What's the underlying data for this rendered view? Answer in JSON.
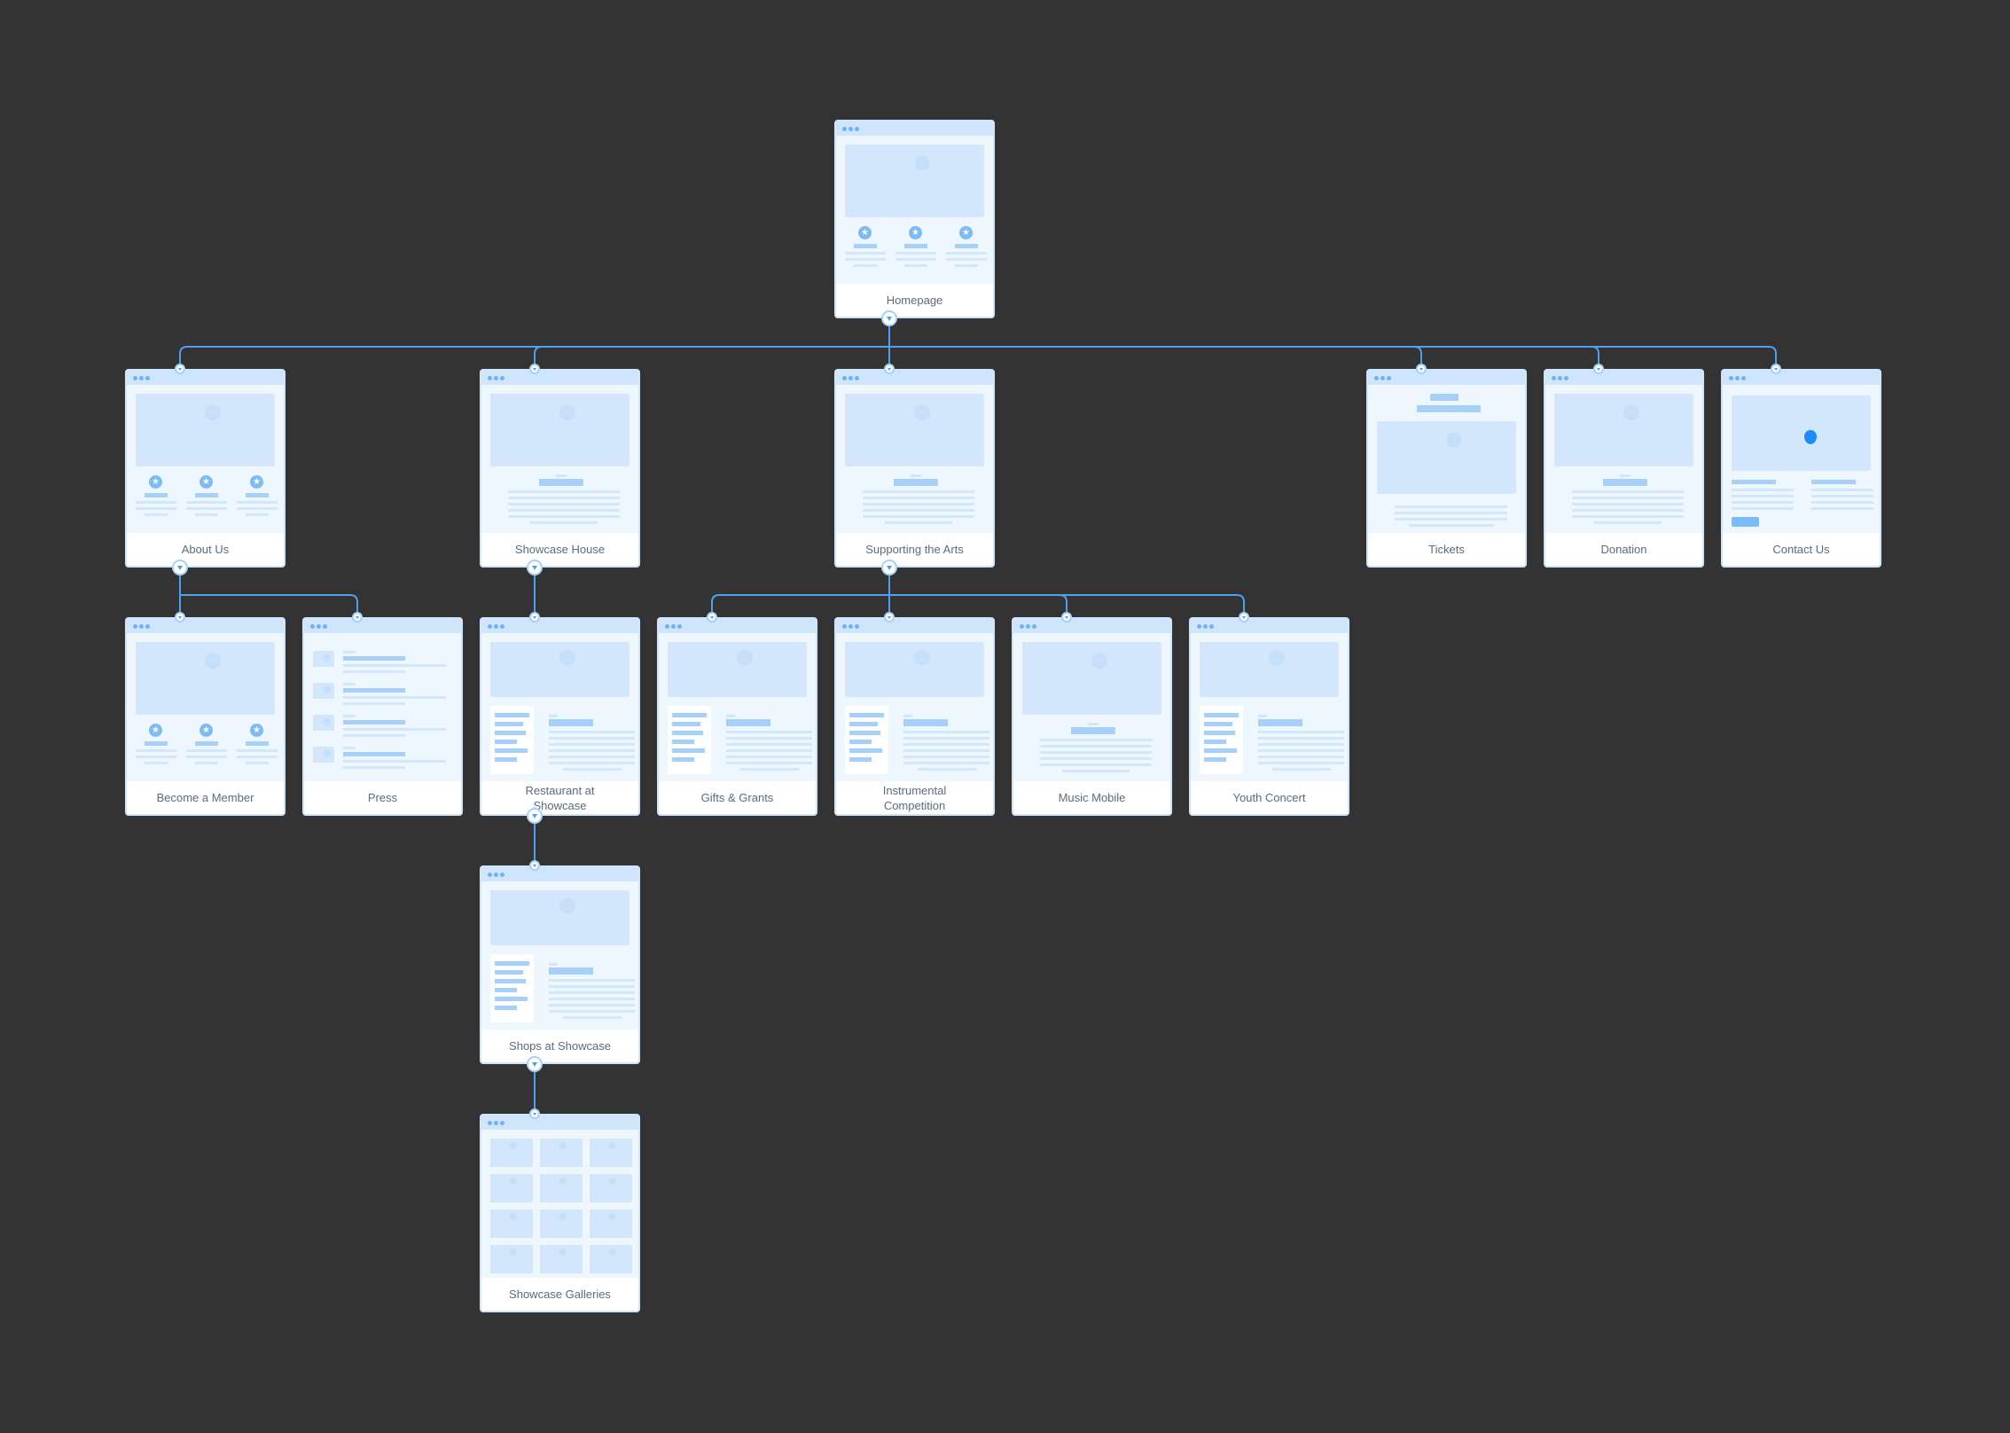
{
  "diagram": {
    "type": "sitemap",
    "connector_color": "#4d9ff0",
    "card_colors": {
      "frame": "#cfe5fb",
      "body": "#eef6fe",
      "accent": "#a7d0f8",
      "pin": "#1a8cff"
    },
    "pages": [
      {
        "id": "homepage",
        "label": "Homepage",
        "parent": null,
        "layout": "hero-features",
        "row": 0,
        "col": 4,
        "expanded": true
      },
      {
        "id": "about-us",
        "label": "About Us",
        "parent": "homepage",
        "layout": "hero-features",
        "row": 1,
        "col": 0,
        "expanded": true
      },
      {
        "id": "showcase-house",
        "label": "Showcase House",
        "parent": "homepage",
        "layout": "hero-text",
        "row": 1,
        "col": 2,
        "expanded": true
      },
      {
        "id": "supporting-the-arts",
        "label": "Supporting the Arts",
        "parent": "homepage",
        "layout": "hero-text",
        "row": 1,
        "col": 4,
        "expanded": true
      },
      {
        "id": "tickets",
        "label": "Tickets",
        "parent": "homepage",
        "layout": "title-hero",
        "row": 1,
        "col": 7,
        "expanded": false
      },
      {
        "id": "donation",
        "label": "Donation",
        "parent": "homepage",
        "layout": "hero-text",
        "row": 1,
        "col": 8,
        "expanded": false
      },
      {
        "id": "contact-us",
        "label": "Contact Us",
        "parent": "homepage",
        "layout": "map-contact",
        "row": 1,
        "col": 9,
        "expanded": false
      },
      {
        "id": "become-a-member",
        "label": "Become a Member",
        "parent": "about-us",
        "layout": "hero-features",
        "row": 2,
        "col": 0,
        "expanded": false
      },
      {
        "id": "press",
        "label": "Press",
        "parent": "about-us",
        "layout": "list",
        "row": 2,
        "col": 1,
        "expanded": false
      },
      {
        "id": "restaurant-at-showcase",
        "label": "Restaurant at Showcase",
        "parent": "showcase-house",
        "layout": "hero-sidebar",
        "row": 2,
        "col": 2,
        "expanded": true
      },
      {
        "id": "gifts-grants",
        "label": "Gifts & Grants",
        "parent": "supporting-the-arts",
        "layout": "hero-sidebar",
        "row": 2,
        "col": 3,
        "expanded": false
      },
      {
        "id": "instrumental-competition",
        "label": "Instrumental Competition",
        "parent": "supporting-the-arts",
        "layout": "hero-sidebar",
        "row": 2,
        "col": 4,
        "expanded": false
      },
      {
        "id": "music-mobile",
        "label": "Music Mobile",
        "parent": "supporting-the-arts",
        "layout": "hero-text",
        "row": 2,
        "col": 5,
        "expanded": false
      },
      {
        "id": "youth-concert",
        "label": "Youth Concert",
        "parent": "supporting-the-arts",
        "layout": "hero-sidebar",
        "row": 2,
        "col": 6,
        "expanded": false
      },
      {
        "id": "shops-at-showcase",
        "label": "Shops at Showcase",
        "parent": "restaurant-at-showcase",
        "layout": "hero-sidebar",
        "row": 3,
        "col": 2,
        "expanded": true
      },
      {
        "id": "showcase-galleries",
        "label": "Showcase Galleries",
        "parent": "shops-at-showcase",
        "layout": "gallery",
        "row": 4,
        "col": 2,
        "expanded": false
      }
    ]
  }
}
